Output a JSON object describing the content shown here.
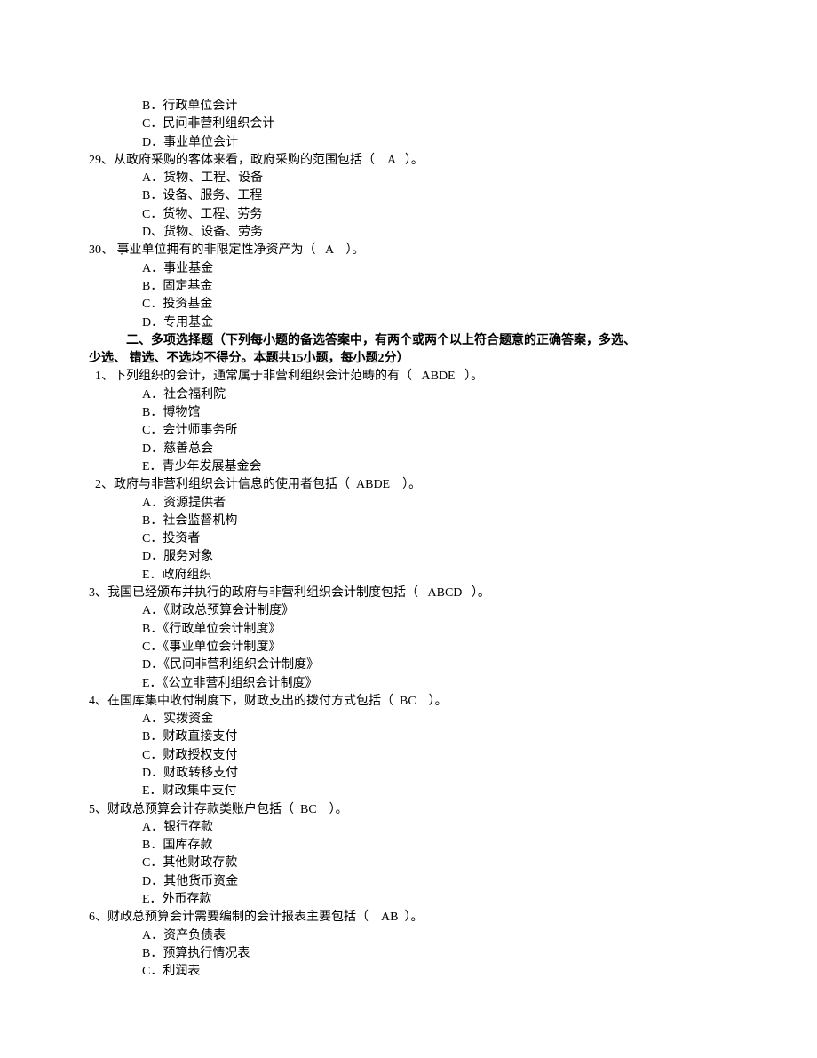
{
  "prev_options": {
    "b": "B．行政单位会计",
    "c": "C．民间非营利组织会计",
    "d": "D．事业单位会计"
  },
  "q29": {
    "stem": "29、从政府采购的客体来看，政府采购的范围包括（    A   ）。",
    "a": "A．货物、工程、设备",
    "b": "B．设备、服务、工程",
    "c": "C．货物、工程、劳务",
    "d": "D、货物、设备、劳务"
  },
  "q30": {
    "stem": "30、 事业单位拥有的非限定性净资产为（   A    ）。",
    "a": "A．事业基金",
    "b": "B．固定基金",
    "c": "C．投资基金",
    "d": "D．专用基金"
  },
  "section2": {
    "line1": "二、多项选择题（下列每小题的备选答案中，有两个或两个以上符合题意的正确答案，多选、",
    "line2": "少选、 错选、不选均不得分。本题共15小题，每小题2分）"
  },
  "mq1": {
    "stem": "  1、下列组织的会计，通常属于非营利组织会计范畴的有（   ABDE   ）。",
    "a": "A．社会福利院",
    "b": "B．博物馆",
    "c": "C．会计师事务所",
    "d": "D．慈善总会",
    "e": "E．青少年发展基金会"
  },
  "mq2": {
    "stem": "  2、政府与非营利组织会计信息的使用者包括（  ABDE    ）。",
    "a": "A．资源提供者",
    "b": "B．社会监督机构",
    "c": "C．投资者",
    "d": "D．服务对象",
    "e": "E．政府组织"
  },
  "mq3": {
    "stem": "3、我国已经颁布并执行的政府与非营利组织会计制度包括（   ABCD   ）。",
    "a": "A．《财政总预算会计制度》",
    "b": "B．《行政单位会计制度》",
    "c": "C．《事业单位会计制度》",
    "d": "D．《民间非营利组织会计制度》",
    "e": "E．《公立非营利组织会计制度》"
  },
  "mq4": {
    "stem": "4、在国库集中收付制度下，财政支出的拨付方式包括（  BC    ）。",
    "a": "A．实拨资金",
    "b": "B．财政直接支付",
    "c": "C．财政授权支付",
    "d": "D．财政转移支付",
    "e": "E．财政集中支付"
  },
  "mq5": {
    "stem": "5、财政总预算会计存款类账户包括（  BC    ）。",
    "a": "A．银行存款",
    "b": "B．国库存款",
    "c": "C．其他财政存款",
    "d": "D．其他货币资金",
    "e": "E．外币存款"
  },
  "mq6": {
    "stem": "6、财政总预算会计需要编制的会计报表主要包括（    AB  ）。",
    "a": "A．资产负债表",
    "b": "B．预算执行情况表",
    "c": "C．利润表"
  }
}
